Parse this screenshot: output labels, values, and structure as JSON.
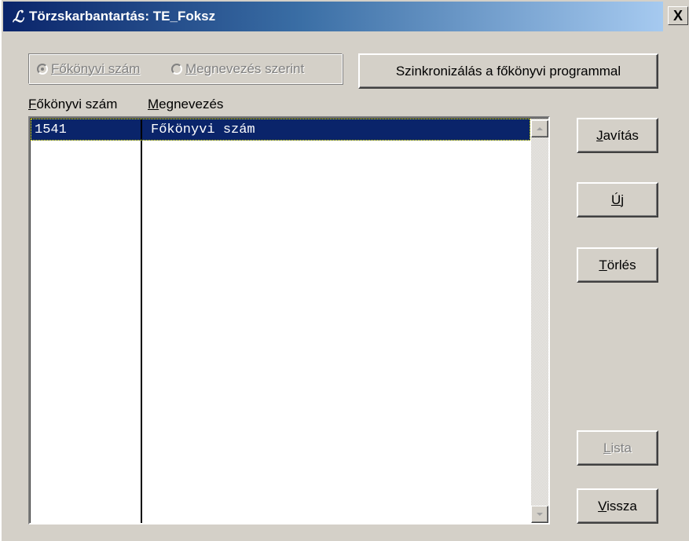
{
  "window": {
    "title": "Törzskarbantartás: TE_Foksz",
    "close_label": "X"
  },
  "radio_group": {
    "options": [
      {
        "label": "Főkönyvi szám",
        "selected": true,
        "enabled": false
      },
      {
        "label": "Megnevezés szerint",
        "selected": false,
        "enabled": false
      }
    ]
  },
  "sync_button": {
    "label": "Szinkronizálás a főkönyvi programmal"
  },
  "list": {
    "columns": [
      "Főkönyvi szám",
      "Megnevezés"
    ],
    "rows": [
      {
        "number": "1541",
        "name": "Főkönyvi szám",
        "selected": true
      }
    ]
  },
  "buttons": {
    "javitas": {
      "label": "Javítás",
      "enabled": true
    },
    "uj": {
      "label": "Új",
      "enabled": true
    },
    "torles": {
      "label": "Törlés",
      "enabled": true
    },
    "lista": {
      "label": "Lista",
      "enabled": false
    },
    "vissza": {
      "label": "Vissza",
      "enabled": true
    }
  },
  "colors": {
    "titlebar_start": "#0a246a",
    "titlebar_end": "#a6caf0",
    "selection": "#0a246a",
    "window_bg": "#d4d0c8"
  }
}
